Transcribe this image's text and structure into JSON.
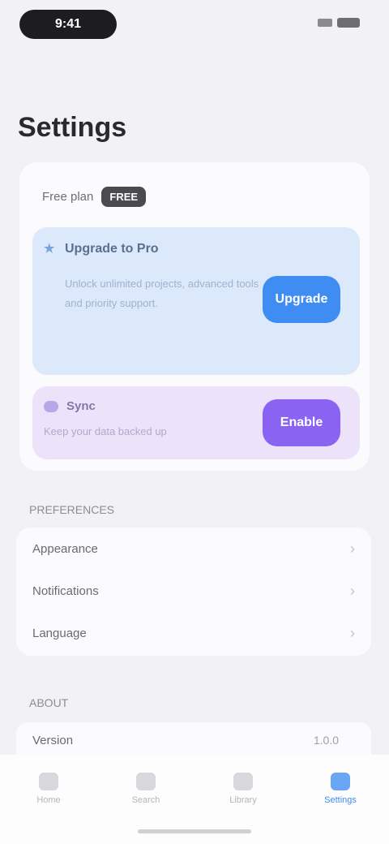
{
  "status_bar": {
    "time": "9:41",
    "battery": "100"
  },
  "page_title": "Settings",
  "account": {
    "label": "Free plan",
    "badge": "FREE"
  },
  "upgrade": {
    "title": "Upgrade to Pro",
    "description": "Unlock unlimited projects, advanced tools and priority support.",
    "button_label": "Upgrade"
  },
  "sync": {
    "title": "Sync",
    "description": "Keep your data backed up",
    "button_label": "Enable"
  },
  "preferences": {
    "section_label": "PREFERENCES",
    "items": [
      {
        "label": "Appearance"
      },
      {
        "label": "Notifications"
      },
      {
        "label": "Language"
      }
    ]
  },
  "about": {
    "section_label": "ABOUT",
    "row_label": "Version",
    "row_value": "1.0.0"
  },
  "tabs": [
    {
      "label": "Home",
      "icon": "home-icon"
    },
    {
      "label": "Search",
      "icon": "search-icon"
    },
    {
      "label": "Library",
      "icon": "library-icon"
    },
    {
      "label": "Settings",
      "icon": "gear-icon"
    }
  ],
  "colors": {
    "accent_blue": "#3f8df2",
    "accent_purple": "#8a63f3"
  }
}
